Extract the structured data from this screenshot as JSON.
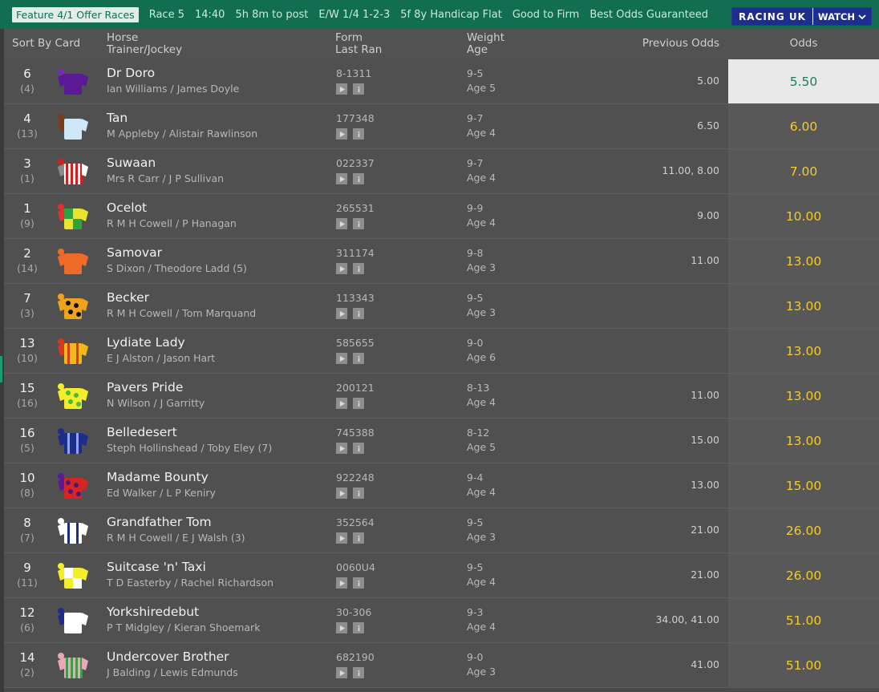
{
  "topbar": {
    "feature": "Feature 4/1 Offer Races",
    "race": "Race 5",
    "time": "14:40",
    "countdown": "5h 8m to post",
    "ew": "E/W 1/4 1-2-3",
    "distance": "5f 8y Handicap Flat",
    "going": "Good to Firm",
    "bog": "Best Odds Guaranteed",
    "provider": "RACING UK",
    "watch": "WATCH"
  },
  "header": {
    "sort": "Sort By Card",
    "horse": "Horse",
    "trainer_jockey": "Trainer/Jockey",
    "form": "Form",
    "last_ran": "Last Ran",
    "weight": "Weight",
    "age": "Age",
    "previous_odds": "Previous Odds",
    "odds": "Odds"
  },
  "colors": {
    "topbar": "#126e51",
    "odds_text": "#f2cc2a",
    "selected_bg": "#e9e9e9",
    "selected_text": "#1f7a5a"
  },
  "runners": [
    {
      "num": "6",
      "draw": "(4)",
      "name": "Dr Doro",
      "tj": "Ian Williams / James Doyle",
      "form": "8-1311",
      "weight": "9-5",
      "age": "Age 5",
      "prev": "5.00",
      "odds": "5.50",
      "selected": true,
      "silk": {
        "body": "#5a1a96",
        "sleeves": "#5a1a96",
        "cap": "#7a2bb5",
        "pattern": "plain",
        "pc": "#ffffff"
      }
    },
    {
      "num": "4",
      "draw": "(13)",
      "name": "Tan",
      "tj": "M Appleby / Alistair Rawlinson",
      "form": "177348",
      "weight": "9-7",
      "age": "Age 4",
      "prev": "6.50",
      "odds": "6.00",
      "silk": {
        "body": "#cfe8f7",
        "sleeves": "#7a3b1a",
        "cap": "#7a3b1a",
        "pattern": "plain",
        "pc": "#ffffff"
      }
    },
    {
      "num": "3",
      "draw": "(1)",
      "name": "Suwaan",
      "tj": "Mrs R Carr / J P Sullivan",
      "form": "022337",
      "weight": "9-7",
      "age": "Age 4",
      "prev": "11.00, 8.00",
      "odds": "7.00",
      "silk": {
        "body": "#ffffff",
        "sleeves": "#8a8a8a",
        "cap": "#d21f1f",
        "pattern": "vstripes",
        "pc": "#d21f1f"
      }
    },
    {
      "num": "1",
      "draw": "(9)",
      "name": "Ocelot",
      "tj": "R M H Cowell / P Hanagan",
      "form": "265531",
      "weight": "9-9",
      "age": "Age 4",
      "prev": "9.00",
      "odds": "10.00",
      "silk": {
        "body": "#e8e230",
        "sleeves": "#e33030",
        "cap": "#e33030",
        "pattern": "quarters",
        "pc": "#2fa23f"
      }
    },
    {
      "num": "2",
      "draw": "(14)",
      "name": "Samovar",
      "tj": "S Dixon / Theodore Ladd (5)",
      "form": "311174",
      "weight": "9-8",
      "age": "Age 3",
      "prev": "11.00",
      "odds": "13.00",
      "silk": {
        "body": "#f06a28",
        "sleeves": "#f06a28",
        "cap": "#f06a28",
        "pattern": "plain",
        "pc": "#ffffff"
      }
    },
    {
      "num": "7",
      "draw": "(3)",
      "name": "Becker",
      "tj": "R M H Cowell / Tom Marquand",
      "form": "113343",
      "weight": "9-5",
      "age": "Age 3",
      "prev": "",
      "odds": "13.00",
      "silk": {
        "body": "#f0a21a",
        "sleeves": "#f0a21a",
        "cap": "#f0a21a",
        "pattern": "spots",
        "pc": "#111111"
      }
    },
    {
      "num": "13",
      "draw": "(10)",
      "name": "Lydiate Lady",
      "tj": "E J Alston / Jason Hart",
      "form": "585655",
      "weight": "9-0",
      "age": "Age 6",
      "prev": "",
      "odds": "13.00",
      "silk": {
        "body": "#f0b81a",
        "sleeves": "#d63a1a",
        "cap": "#d63a1a",
        "pattern": "braces",
        "pc": "#d63a1a"
      }
    },
    {
      "num": "15",
      "draw": "(16)",
      "name": "Pavers Pride",
      "tj": "N Wilson / J Garritty",
      "form": "200121",
      "weight": "8-13",
      "age": "Age 4",
      "prev": "11.00",
      "odds": "13.00",
      "silk": {
        "body": "#f2ef2a",
        "sleeves": "#f2ef2a",
        "cap": "#f2ef2a",
        "pattern": "spots",
        "pc": "#4fb83a"
      }
    },
    {
      "num": "16",
      "draw": "(5)",
      "name": "Belledesert",
      "tj": "Steph Hollinshead / Toby Eley (7)",
      "form": "745388",
      "weight": "8-12",
      "age": "Age 5",
      "prev": "15.00",
      "odds": "13.00",
      "silk": {
        "body": "#1c2d8a",
        "sleeves": "#1c2d8a",
        "cap": "#1c2d8a",
        "pattern": "braces",
        "pc": "#8ea4f0"
      }
    },
    {
      "num": "10",
      "draw": "(8)",
      "name": "Madame Bounty",
      "tj": "Ed Walker / L P Keniry",
      "form": "922248",
      "weight": "9-4",
      "age": "Age 4",
      "prev": "13.00",
      "odds": "15.00",
      "silk": {
        "body": "#d92424",
        "sleeves": "#5a1a96",
        "cap": "#5a1a96",
        "pattern": "spots",
        "pc": "#4a1a7a"
      }
    },
    {
      "num": "8",
      "draw": "(7)",
      "name": "Grandfather Tom",
      "tj": "R M H Cowell / E J Walsh (3)",
      "form": "352564",
      "weight": "9-5",
      "age": "Age 3",
      "prev": "21.00",
      "odds": "26.00",
      "silk": {
        "body": "#ffffff",
        "sleeves": "#ffffff",
        "cap": "#ffffff",
        "pattern": "braces",
        "pc": "#1c2d8a"
      }
    },
    {
      "num": "9",
      "draw": "(11)",
      "name": "Suitcase 'n' Taxi",
      "tj": "T D Easterby / Rachel Richardson",
      "form": "0060U4",
      "weight": "9-5",
      "age": "Age 4",
      "prev": "21.00",
      "odds": "26.00",
      "silk": {
        "body": "#f2ef2a",
        "sleeves": "#f2ef2a",
        "cap": "#f2ef2a",
        "pattern": "quarters",
        "pc": "#ffffff"
      }
    },
    {
      "num": "12",
      "draw": "(6)",
      "name": "Yorkshiredebut",
      "tj": "P T Midgley / Kieran Shoemark",
      "form": "30-306",
      "weight": "9-3",
      "age": "Age 4",
      "prev": "34.00, 41.00",
      "odds": "51.00",
      "silk": {
        "body": "#ffffff",
        "sleeves": "#1c2d8a",
        "cap": "#1c2d8a",
        "pattern": "plain",
        "pc": "#ffffff"
      }
    },
    {
      "num": "14",
      "draw": "(2)",
      "name": "Undercover Brother",
      "tj": "J Balding / Lewis Edmunds",
      "form": "682190",
      "weight": "9-0",
      "age": "Age 3",
      "prev": "41.00",
      "odds": "51.00",
      "silk": {
        "body": "#e8a8b8",
        "sleeves": "#e8a8b8",
        "cap": "#e8a8b8",
        "pattern": "vstripes",
        "pc": "#3f9a4a"
      }
    }
  ]
}
